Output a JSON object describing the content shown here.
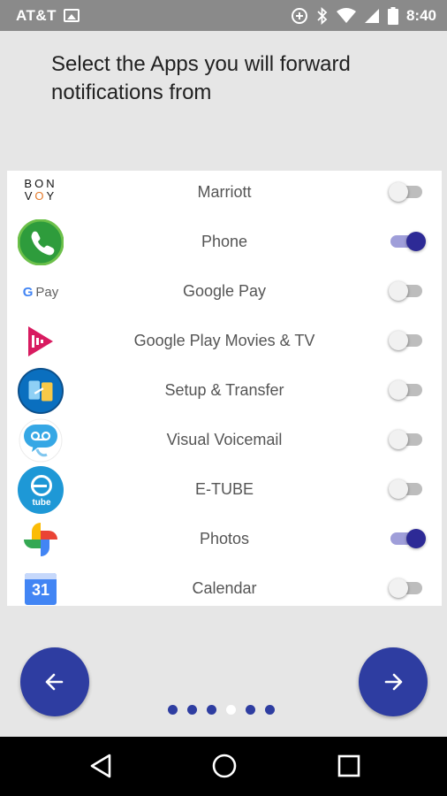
{
  "status_bar": {
    "carrier": "AT&T",
    "time": "8:40"
  },
  "title": "Select the Apps you will forward notifications from",
  "apps": [
    {
      "name": "Marriott",
      "icon": "marriott-bonvoy-icon",
      "icon_text": "BON VOY",
      "enabled": false
    },
    {
      "name": "Phone",
      "icon": "phone-icon",
      "enabled": true
    },
    {
      "name": "Google Pay",
      "icon": "google-pay-icon",
      "icon_text": "Pay",
      "enabled": false
    },
    {
      "name": "Google Play Movies & TV",
      "icon": "play-movies-icon",
      "enabled": false
    },
    {
      "name": "Setup & Transfer",
      "icon": "setup-transfer-icon",
      "enabled": false
    },
    {
      "name": "Visual Voicemail",
      "icon": "visual-voicemail-icon",
      "enabled": false
    },
    {
      "name": "E-TUBE",
      "icon": "etube-icon",
      "icon_text": "tube",
      "enabled": false
    },
    {
      "name": "Photos",
      "icon": "google-photos-icon",
      "enabled": true
    },
    {
      "name": "Calendar",
      "icon": "calendar-icon",
      "icon_text": "31",
      "enabled": false
    }
  ],
  "pager": {
    "total": 6,
    "current": 4
  },
  "colors": {
    "accent": "#2e3da1",
    "toggle_on": "#2d2a96",
    "toggle_track_on": "#9f9ed9",
    "background": "#e6e6e6",
    "status_bar": "#8a8a8a"
  }
}
